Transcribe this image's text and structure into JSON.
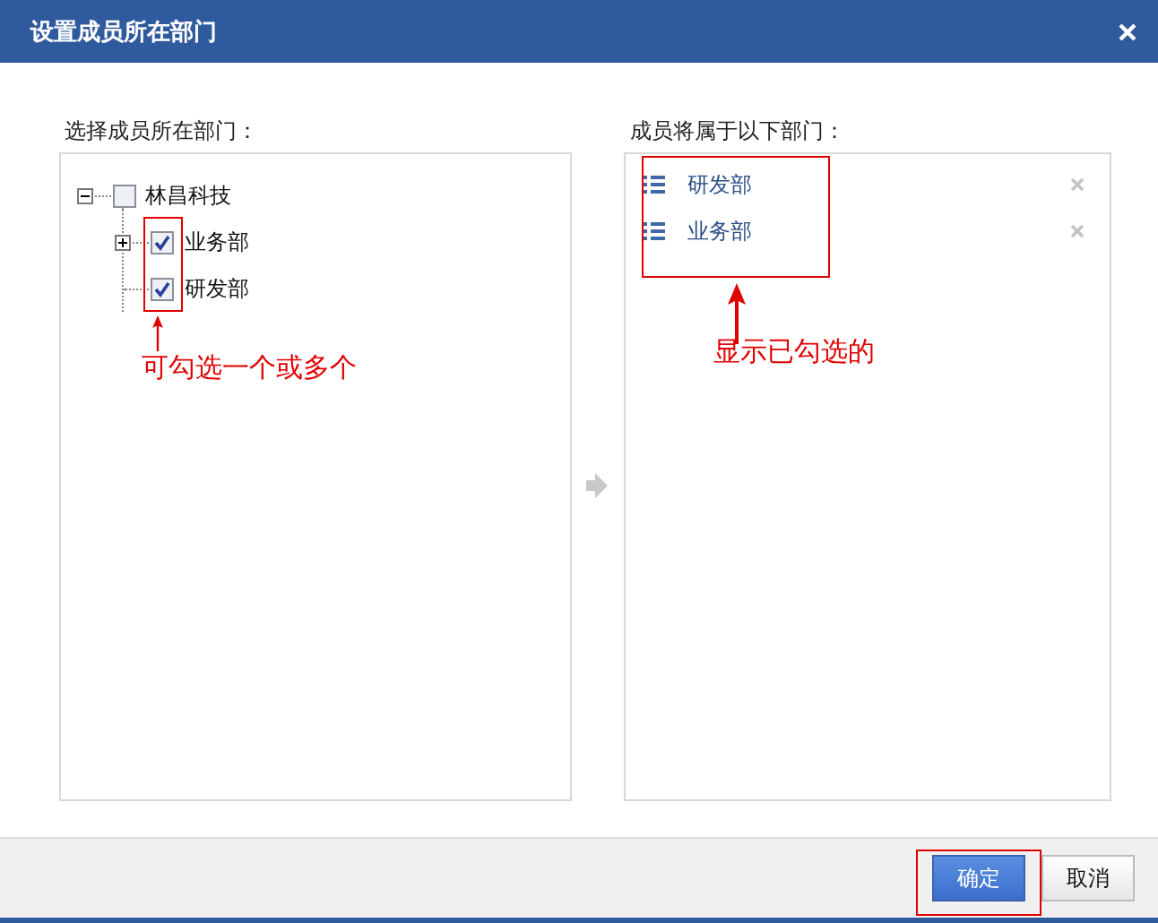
{
  "window": {
    "title": "设置成员所在部门"
  },
  "left_panel": {
    "label": "选择成员所在部门：",
    "tree": [
      {
        "label": "林昌科技",
        "checked": false,
        "expanded": true,
        "children": [
          {
            "label": "业务部",
            "checked": true,
            "expanded": false
          },
          {
            "label": "研发部",
            "checked": true
          }
        ]
      }
    ]
  },
  "right_panel": {
    "label": "成员将属于以下部门：",
    "items": [
      {
        "label": "研发部"
      },
      {
        "label": "业务部"
      }
    ]
  },
  "annotations": [
    {
      "kind": "note",
      "text": "可勾选一个或多个"
    },
    {
      "kind": "note",
      "text": "显示已勾选的"
    },
    {
      "kind": "box"
    }
  ],
  "buttons": [
    {
      "label": "确定",
      "kind": "primary"
    },
    {
      "label": "取消",
      "kind": "secondary"
    }
  ]
}
